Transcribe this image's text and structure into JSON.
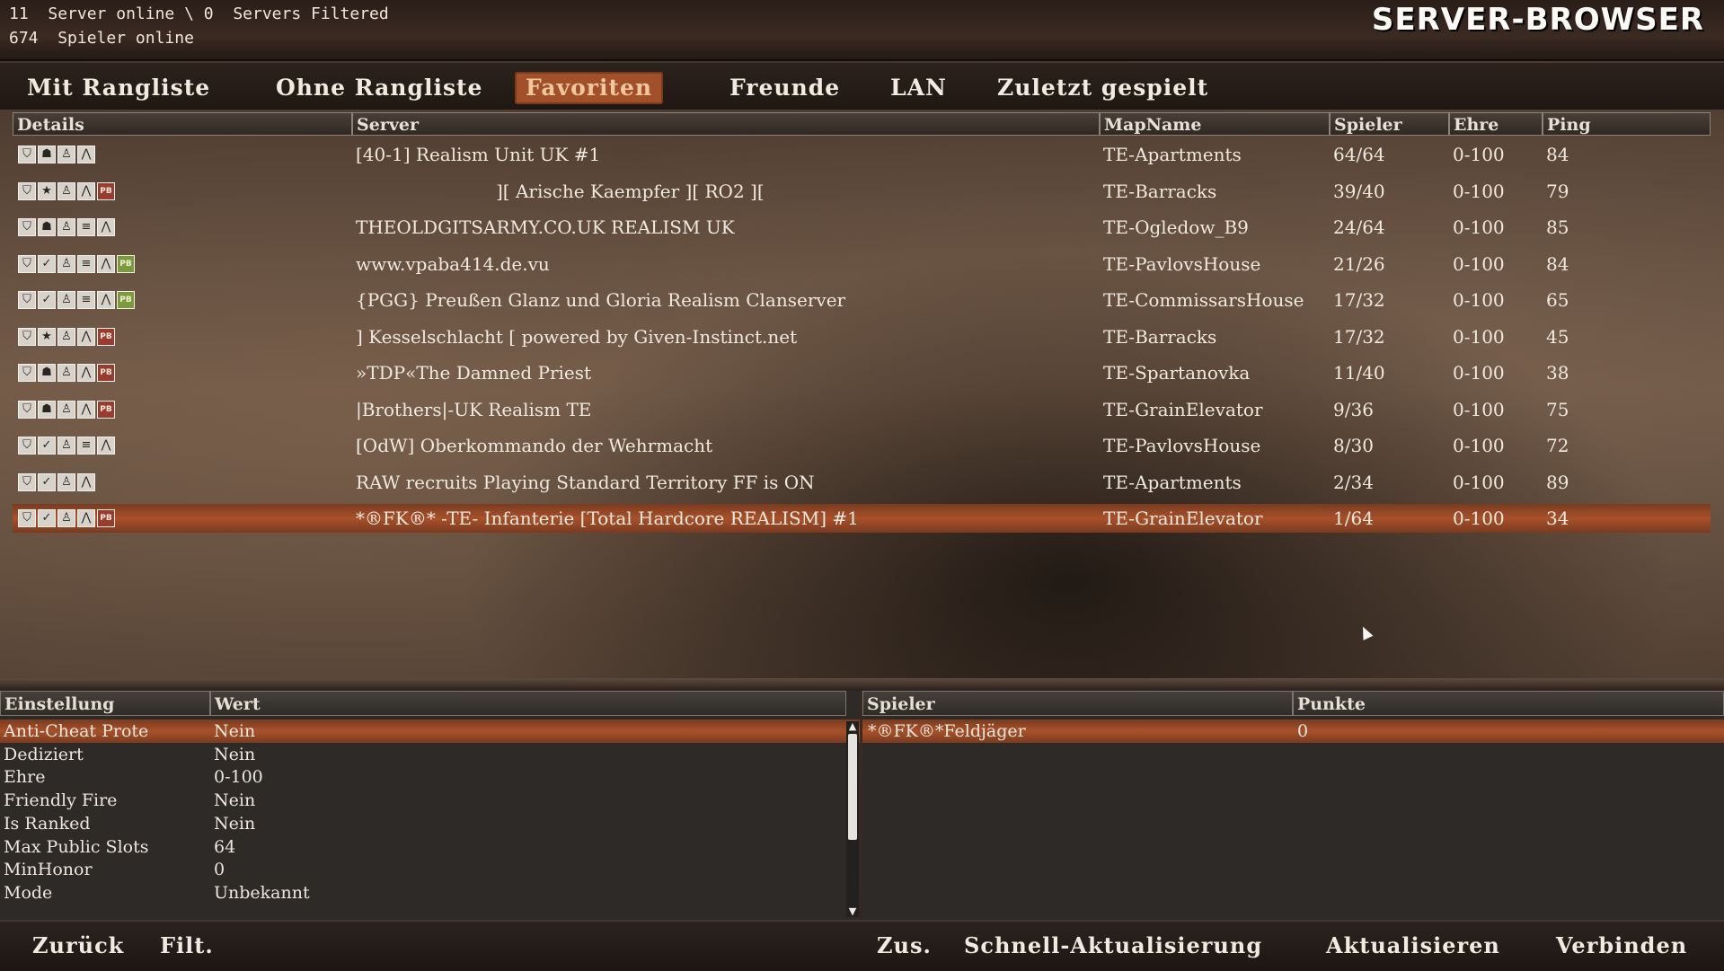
{
  "header": {
    "servers_online_count": "11",
    "servers_online_label": "Server online \\",
    "servers_filtered_count": "0",
    "servers_filtered_label": "Servers Filtered",
    "players_online_count": "674",
    "players_online_label": "Spieler online",
    "title": "SERVER-BROWSER"
  },
  "tabs": [
    "Mit Rangliste",
    "Ohne Rangliste",
    "Favoriten",
    "Freunde",
    "LAN",
    "Zuletzt gespielt"
  ],
  "active_tab": "Favoriten",
  "server_table": {
    "columns": [
      "Details",
      "Server",
      "MapName",
      "Spieler",
      "Ehre",
      "Ping"
    ],
    "rows": [
      {
        "icons": [
          "shield-icon",
          "helmet-icon",
          "soldier-icon",
          "rank-icon"
        ],
        "server": "[40-1] Realism Unit UK #1",
        "map": "TE-Apartments",
        "players": "64/64",
        "honor": "0-100",
        "ping": "84"
      },
      {
        "icons": [
          "shield-icon",
          "star-icon",
          "soldier-icon",
          "rank-icon",
          "pb-icon"
        ],
        "server": "][ Arische Kaempfer ][ RO2 ][",
        "map": "TE-Barracks",
        "players": "39/40",
        "honor": "0-100",
        "ping": "79"
      },
      {
        "icons": [
          "shield-icon",
          "helmet-icon",
          "soldier-icon",
          "weapon-icon",
          "rank-icon"
        ],
        "server": "THEOLDGITSARMY.CO.UK REALISM UK",
        "map": "TE-Ogledow_B9",
        "players": "24/64",
        "honor": "0-100",
        "ping": "85"
      },
      {
        "icons": [
          "shield-icon",
          "check-icon",
          "soldier-icon",
          "weapon-icon",
          "rank-icon",
          "pbg-icon"
        ],
        "server": "www.vpaba414.de.vu",
        "map": "TE-PavlovsHouse",
        "players": "21/26",
        "honor": "0-100",
        "ping": "84"
      },
      {
        "icons": [
          "shield-icon",
          "check-icon",
          "soldier-icon",
          "weapon-icon",
          "rank-icon",
          "pbg-icon"
        ],
        "server": "{PGG} Preußen Glanz und Gloria Realism Clanserver",
        "map": "TE-CommissarsHouse",
        "players": "17/32",
        "honor": "0-100",
        "ping": "65"
      },
      {
        "icons": [
          "shield-icon",
          "star-icon",
          "soldier-icon",
          "rank-icon",
          "pb-icon"
        ],
        "server": "] Kesselschlacht [ powered by Given-Instinct.net",
        "map": "TE-Barracks",
        "players": "17/32",
        "honor": "0-100",
        "ping": "45"
      },
      {
        "icons": [
          "shield-icon",
          "helmet-icon",
          "soldier-icon",
          "rank-icon",
          "pb-icon"
        ],
        "server": "»TDP«The Damned Priest",
        "map": "TE-Spartanovka",
        "players": "11/40",
        "honor": "0-100",
        "ping": "38"
      },
      {
        "icons": [
          "shield-icon",
          "helmet-icon",
          "soldier-icon",
          "rank-icon",
          "pb-icon"
        ],
        "server": "|Brothers|-UK Realism TE",
        "map": "TE-GrainElevator",
        "players": "9/36",
        "honor": "0-100",
        "ping": "75"
      },
      {
        "icons": [
          "shield-icon",
          "check-icon",
          "soldier-icon",
          "weapon-icon",
          "rank-icon"
        ],
        "server": "[OdW] Oberkommando der Wehrmacht",
        "map": "TE-PavlovsHouse",
        "players": "8/30",
        "honor": "0-100",
        "ping": "72"
      },
      {
        "icons": [
          "shield-icon",
          "check-icon",
          "soldier-icon",
          "rank-icon"
        ],
        "server": "RAW recruits Playing Standard Territory FF is ON",
        "map": "TE-Apartments",
        "players": "2/34",
        "honor": "0-100",
        "ping": "89"
      },
      {
        "icons": [
          "shield-icon",
          "check-icon",
          "soldier-icon",
          "rank-icon",
          "pb-icon"
        ],
        "server": "*®FK®* -TE- Infanterie [Total Hardcore REALISM] #1",
        "map": "TE-GrainElevator",
        "players": "1/64",
        "honor": "0-100",
        "ping": "34"
      }
    ],
    "selected_index": 10
  },
  "icon_glyphs": {
    "shield-icon": "⛉",
    "helmet-icon": "☗",
    "soldier-icon": "♙",
    "rank-icon": "⋀",
    "star-icon": "★",
    "check-icon": "✓",
    "weapon-icon": "≡",
    "pb-icon": "PB",
    "pbg-icon": "PB"
  },
  "settings_panel": {
    "columns": [
      "Einstellung",
      "Wert"
    ],
    "rows": [
      {
        "key": "Anti-Cheat Prote",
        "value": "Nein"
      },
      {
        "key": "Dediziert",
        "value": "Nein"
      },
      {
        "key": "Ehre",
        "value": "0-100"
      },
      {
        "key": "Friendly Fire",
        "value": "Nein"
      },
      {
        "key": "Is Ranked",
        "value": "Nein"
      },
      {
        "key": "Max Public Slots",
        "value": "64"
      },
      {
        "key": "MinHonor",
        "value": "0"
      },
      {
        "key": "Mode",
        "value": "Unbekannt"
      }
    ],
    "selected_index": 0
  },
  "players_panel": {
    "columns": [
      "Spieler",
      "Punkte"
    ],
    "rows": [
      {
        "name": "*®FK®*Feldjäger",
        "points": "0"
      }
    ],
    "selected_index": 0
  },
  "bottom_bar": {
    "back": "Zurück",
    "filter": "Filt.",
    "add": "Zus.",
    "quick_refresh": "Schnell-Aktualisierung",
    "refresh": "Aktualisieren",
    "connect": "Verbinden"
  },
  "colors": {
    "accent": "#a1502a",
    "selection": "#a8512a"
  }
}
